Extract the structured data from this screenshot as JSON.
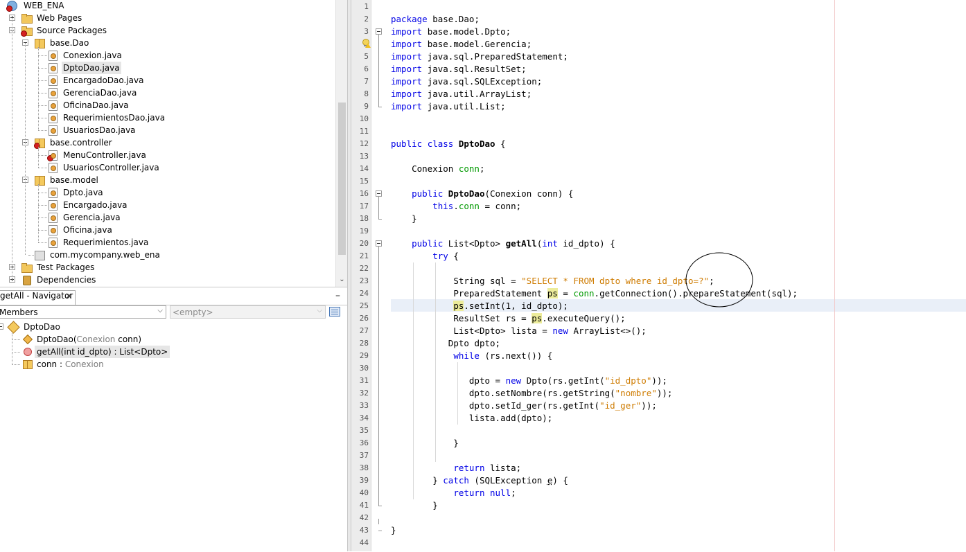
{
  "projects": {
    "root": "WEB_ENA",
    "web_pages": "Web Pages",
    "source_packages": "Source Packages",
    "packages": [
      {
        "name": "base.Dao",
        "files": [
          "Conexion.java",
          "DptoDao.java",
          "EncargadoDao.java",
          "GerenciaDao.java",
          "OficinaDao.java",
          "RequerimientosDao.java",
          "UsuariosDao.java"
        ]
      },
      {
        "name": "base.controller",
        "files": [
          "MenuController.java",
          "UsuariosController.java"
        ]
      },
      {
        "name": "base.model",
        "files": [
          "Dpto.java",
          "Encargado.java",
          "Gerencia.java",
          "Oficina.java",
          "Requerimientos.java"
        ]
      },
      {
        "name": "com.mycompany.web_ena",
        "files": []
      }
    ],
    "selected_file": "DptoDao.java",
    "test_packages": "Test Packages",
    "dependencies": "Dependencies"
  },
  "navigator": {
    "title": "getAll - Navigator",
    "view_mode": "Members",
    "filter_placeholder": "<empty>",
    "class_name": "DptoDao",
    "members": [
      {
        "name": "DptoDao(",
        "type": "Conexion",
        "rest": " conn)",
        "kind": "constructor"
      },
      {
        "name": "getAll(int id_dpto) : List<Dpto>",
        "kind": "method",
        "selected": true
      },
      {
        "name": "conn : ",
        "type": "Conexion",
        "kind": "field"
      }
    ]
  },
  "editor": {
    "current_line": 25,
    "code_lines": [
      "",
      "package base.Dao;",
      "import base.model.Dpto;",
      "import base.model.Gerencia;",
      "import java.sql.PreparedStatement;",
      "import java.sql.ResultSet;",
      "import java.sql.SQLException;",
      "import java.util.ArrayList;",
      "import java.util.List;",
      "",
      "",
      "public class DptoDao {",
      "",
      "    Conexion conn;",
      "",
      "    public DptoDao(Conexion conn) {",
      "        this.conn = conn;",
      "    }",
      "",
      "    public List<Dpto> getAll(int id_dpto) {",
      "        try {",
      "",
      "            String sql = \"SELECT * FROM dpto where id_dpto=?\";",
      "            PreparedStatement ps = conn.getConnection().prepareStatement(sql);",
      "            ps.setInt(1, id_dpto);",
      "            ResultSet rs = ps.executeQuery();",
      "            List<Dpto> lista = new ArrayList<>();",
      "           Dpto dpto;",
      "            while (rs.next()) {",
      "",
      "               dpto = new Dpto(rs.getInt(\"id_dpto\"));",
      "               dpto.setNombre(rs.getString(\"nombre\"));",
      "               dpto.setId_ger(rs.getInt(\"id_ger\"));",
      "               lista.add(dpto);",
      "",
      "            }",
      "",
      "            return lista;",
      "        } catch (SQLException e) {",
      "            return null;",
      "        }",
      "",
      "}",
      ""
    ]
  },
  "icons": {
    "tree_expand": "plus-minus-box-icon",
    "project": "web-project-icon",
    "package": "package-icon",
    "java_file": "java-file-icon",
    "error_badge": "error-badge-icon"
  },
  "colors": {
    "keyword": "#0000e6",
    "string": "#ce7b00",
    "field": "#009900",
    "occurrence_mark": "#ecec9a",
    "current_line": "#e9eff8",
    "annotation_circle": "#000000"
  }
}
